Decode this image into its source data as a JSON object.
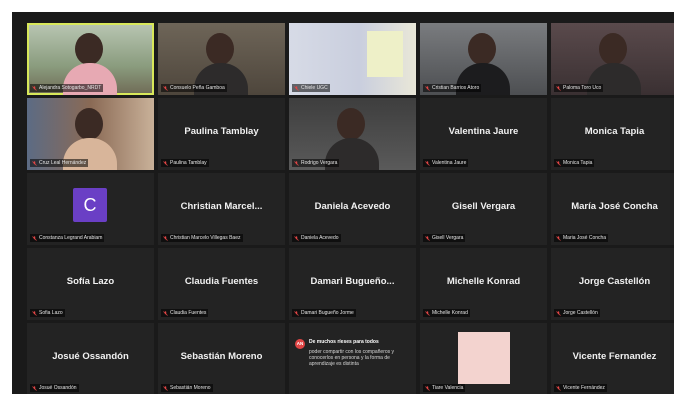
{
  "participants": [
    {
      "label": "Alejandra Sotogarbo_NRDT",
      "active": true
    },
    {
      "label": "Consuelo Peña Gamboa"
    },
    {
      "label": "Chiele UGC"
    },
    {
      "label": "Cristian Barrios Atoro"
    },
    {
      "label": "Paloma Toro Uco"
    },
    {
      "label": "Cruz Leal Hernández"
    },
    {
      "name": "Paulina Tamblay",
      "label": "Paulina Tamblay"
    },
    {
      "label": "Rodrigo Vergara"
    },
    {
      "name": "Valentina Jaure",
      "label": "Valentina Jaure"
    },
    {
      "name": "Monica Tapia",
      "label": "Monica Tapia"
    },
    {
      "avatar": "C",
      "label": "Constanza Legrand Arabiam"
    },
    {
      "name": "Christian  Marcel...",
      "label": "Christian Marcelo Villegas Baez"
    },
    {
      "name": "Daniela Acevedo",
      "label": "Daniela Acevedo"
    },
    {
      "name": "Gisell Vergara",
      "label": "Gisell Vergara"
    },
    {
      "name": "María José Concha",
      "label": "Maria José Concha"
    },
    {
      "name": "Sofía Lazo",
      "label": "Sofia Lazo"
    },
    {
      "name": "Claudia Fuentes",
      "label": "Claudia Fuentes"
    },
    {
      "name": "Damari  Bugueño...",
      "label": "Damari Bugueño Jorme"
    },
    {
      "name": "Michelle Konrad",
      "label": "Michelle Konrad"
    },
    {
      "name": "Jorge Castellón",
      "label": "Jorge Castellón"
    },
    {
      "name": "Josué Ossandón",
      "label": "Josué Ossandón"
    },
    {
      "name": "Sebastián Moreno",
      "label": "Sebastián Moreno"
    },
    {
      "chat": true
    },
    {
      "label": "Tiare Valencia"
    },
    {
      "name": "Vicente Fernandez",
      "label": "Vicente Fernández"
    }
  ],
  "chat_message": {
    "badge": "AN",
    "title": "De muchos ríeses para todos",
    "body": "poder compartir con los compañeros y conocerlos en persona y la forma de aprendizaje es distinta"
  },
  "colors": {
    "background": "#1a1a1a",
    "tile": "#232323",
    "active_border": "#d8e85a",
    "avatar": "#6a3fc5",
    "muted_mic": "#e04545"
  },
  "icons": {
    "muted_mic": "mic-muted-icon",
    "chat_badge": "chat-avatar-icon"
  }
}
